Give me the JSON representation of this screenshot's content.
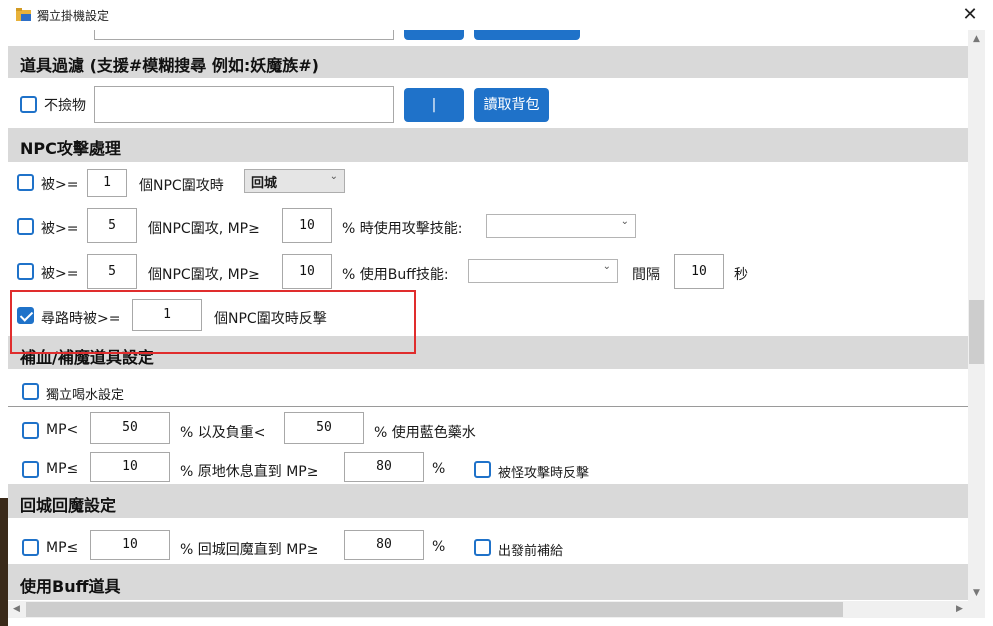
{
  "window": {
    "title": "獨立掛機設定",
    "close": "✕"
  },
  "sections": {
    "item_filter": "道具過濾 (支援#模糊搜尋 例如:妖魔族#)",
    "npc": "NPC攻擊處理",
    "restore": "補血/補魔道具設定",
    "return_city": "回城回魔設定",
    "buff_items": "使用Buff道具"
  },
  "item_filter": {
    "no_pickup_label": "不撿物",
    "no_pickup_checked": false,
    "input_value": "",
    "pipe_button": "|",
    "read_bag_button": "讀取背包"
  },
  "npc": {
    "row1": {
      "checked": false,
      "prefix": "被>=",
      "count": "1",
      "mid": "個NPC圍攻時",
      "select": "回城"
    },
    "row2": {
      "checked": false,
      "prefix": "被>=",
      "count": "5",
      "mid": "個NPC圍攻, MP≥",
      "mp": "10",
      "suffix": "% 時使用攻擊技能:",
      "select": ""
    },
    "row3": {
      "checked": false,
      "prefix": "被>=",
      "count": "5",
      "mid": "個NPC圍攻, MP≥",
      "mp": "10",
      "suffix": "% 使用Buff技能:",
      "select": "",
      "interval_label": "間隔",
      "interval": "10",
      "unit": "秒"
    },
    "row4": {
      "checked": true,
      "prefix": "尋路時被>=",
      "count": "1",
      "suffix": "個NPC圍攻時反擊"
    }
  },
  "restore": {
    "independent_drink_label": "獨立喝水設定",
    "independent_drink_checked": false,
    "rowA": {
      "checked": false,
      "label": "MP<",
      "mp": "50",
      "mid": "% 以及負重<",
      "weight": "50",
      "suffix": "% 使用藍色藥水"
    },
    "rowB": {
      "checked": false,
      "label": "MP≤",
      "mp": "10",
      "mid": "% 原地休息直到 MP≥",
      "target": "80",
      "pct": "%",
      "counter_label": "被怪攻擊時反擊",
      "counter_checked": false
    }
  },
  "return_city": {
    "checked": false,
    "label": "MP≤",
    "mp": "10",
    "mid": "% 回城回魔直到 MP≥",
    "target": "80",
    "pct": "%",
    "resupply_label": "出發前補給",
    "resupply_checked": false
  },
  "scroll": {
    "up": "▲",
    "down": "▼",
    "left": "◀",
    "right": "▶"
  },
  "colors": {
    "accent": "#1f72c9",
    "header_bg": "#d9d9d9",
    "highlight": "#e02d2d"
  }
}
